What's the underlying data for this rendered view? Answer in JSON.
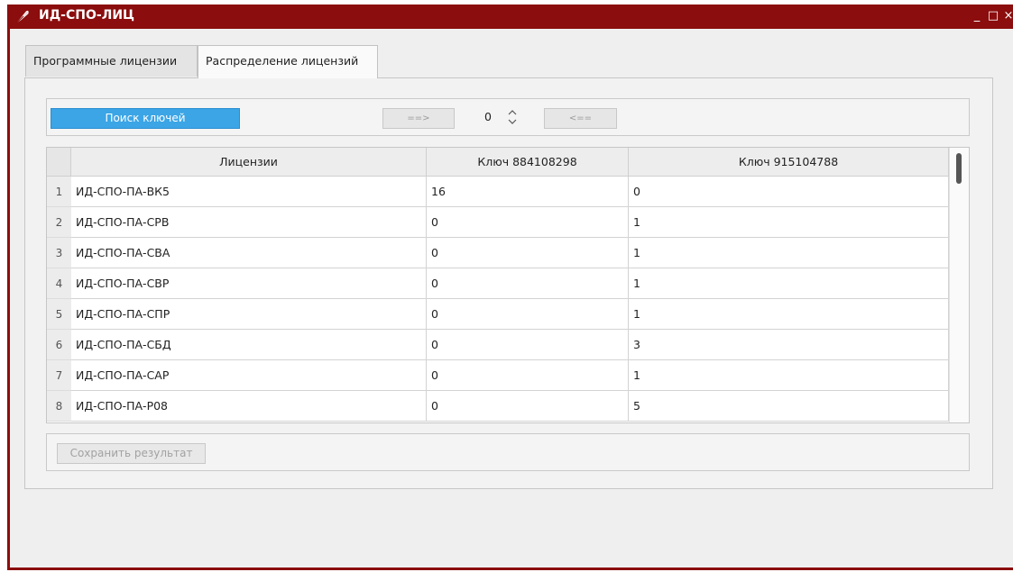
{
  "window": {
    "title": "ИД-СПО-ЛИЦ",
    "icon": "feather-icon",
    "controls": {
      "minimize": "_",
      "maximize": "□",
      "close": "×"
    },
    "accent_color": "#8b0d0d"
  },
  "tabs": [
    {
      "label": "Программные лицензии",
      "active": false
    },
    {
      "label": "Распределение лицензий",
      "active": true
    }
  ],
  "toolbar": {
    "search_label": "Поиск ключей",
    "forward_label": "==>",
    "spinner_value": "0",
    "back_label": "<==",
    "search_color": "#3ba5e6"
  },
  "table": {
    "headers": [
      "Лицензии",
      "Ключ 884108298",
      "Ключ 915104788"
    ],
    "rows": [
      {
        "num": "1",
        "license": "ИД-СПО-ПА-ВК5",
        "key1": "16",
        "key2": "0"
      },
      {
        "num": "2",
        "license": "ИД-СПО-ПА-СРВ",
        "key1": "0",
        "key2": "1"
      },
      {
        "num": "3",
        "license": "ИД-СПО-ПА-СВА",
        "key1": "0",
        "key2": "1"
      },
      {
        "num": "4",
        "license": "ИД-СПО-ПА-СВР",
        "key1": "0",
        "key2": "1"
      },
      {
        "num": "5",
        "license": "ИД-СПО-ПА-СПР",
        "key1": "0",
        "key2": "1"
      },
      {
        "num": "6",
        "license": "ИД-СПО-ПА-СБД",
        "key1": "0",
        "key2": "3"
      },
      {
        "num": "7",
        "license": "ИД-СПО-ПА-САР",
        "key1": "0",
        "key2": "1"
      },
      {
        "num": "8",
        "license": "ИД-СПО-ПА-Р08",
        "key1": "0",
        "key2": "5"
      }
    ]
  },
  "footer": {
    "save_label": "Сохранить результат"
  }
}
